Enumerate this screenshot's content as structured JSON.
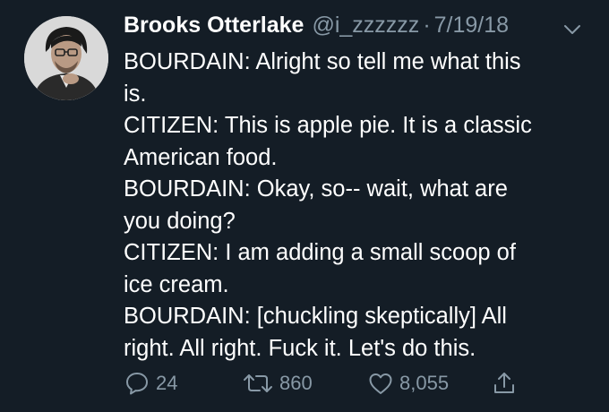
{
  "author": {
    "display_name": "Brooks Otterlake",
    "handle": "@i_zzzzzz",
    "separator": "·",
    "date": "7/19/18"
  },
  "tweet_lines": [
    "BOURDAIN: Alright so tell me what this",
    "is.",
    "CITIZEN: This is apple pie. It is a classic",
    "American food.",
    "BOURDAIN: Okay, so-- wait, what are",
    "you doing?",
    "CITIZEN: I am adding a small scoop of",
    "ice cream.",
    "BOURDAIN: [chuckling skeptically] All",
    "right. All right. Fuck it. Let's do this."
  ],
  "actions": {
    "reply_count": "24",
    "retweet_count": "860",
    "like_count": "8,055"
  },
  "icons": {
    "avatar": "avatar-photo",
    "menu": "chevron-down-icon",
    "reply": "reply-icon",
    "retweet": "retweet-icon",
    "like": "heart-icon",
    "share": "share-icon"
  },
  "colors": {
    "background": "#141d26",
    "text": "#ffffff",
    "muted": "#8899a6"
  }
}
